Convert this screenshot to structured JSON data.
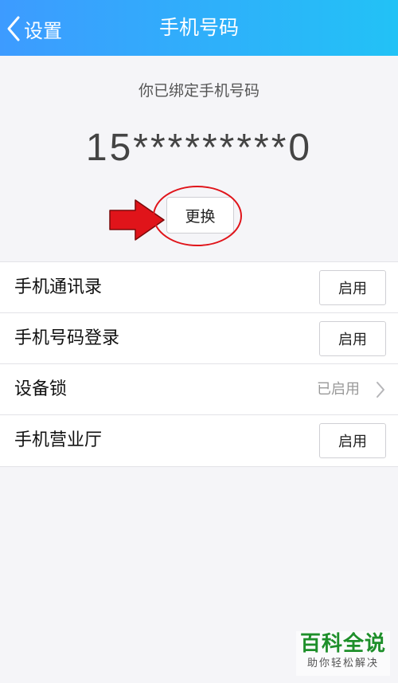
{
  "nav": {
    "back_label": "设置",
    "title": "手机号码"
  },
  "binding": {
    "caption": "你已绑定手机号码",
    "phone": "15*********0",
    "change_label": "更换"
  },
  "settings": [
    {
      "label": "手机通讯录",
      "action_label": "启用"
    },
    {
      "label": "手机号码登录",
      "action_label": "启用"
    },
    {
      "label": "设备锁",
      "status": "已启用"
    },
    {
      "label": "手机营业厅",
      "action_label": "启用"
    }
  ],
  "watermark": {
    "title": "百科全说",
    "subtitle": "助你轻松解决"
  },
  "colors": {
    "nav_start": "#3d9bff",
    "nav_end": "#22c2f6",
    "annotation_red": "#e0141a"
  }
}
